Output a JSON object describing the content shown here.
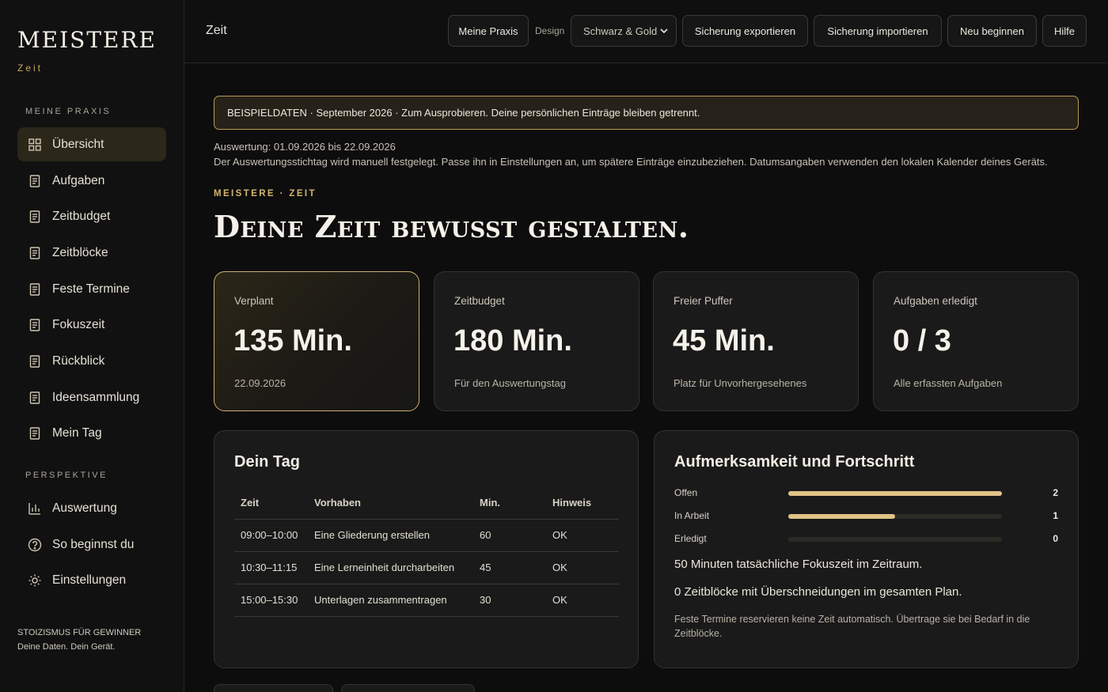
{
  "brand": {
    "title": "MEISTERE",
    "subtitle": "Zeit"
  },
  "sidebar": {
    "section_main": "MEINE PRAXIS",
    "items": [
      {
        "label": "Übersicht",
        "icon": "grid-icon",
        "active": true
      },
      {
        "label": "Aufgaben",
        "icon": "document-icon"
      },
      {
        "label": "Zeitbudget",
        "icon": "document-icon"
      },
      {
        "label": "Zeitblöcke",
        "icon": "document-icon"
      },
      {
        "label": "Feste Termine",
        "icon": "document-icon"
      },
      {
        "label": "Fokuszeit",
        "icon": "document-icon"
      },
      {
        "label": "Rückblick",
        "icon": "document-icon"
      },
      {
        "label": "Ideensammlung",
        "icon": "document-icon"
      },
      {
        "label": "Mein Tag",
        "icon": "document-icon"
      }
    ],
    "section_perspective": "PERSPEKTIVE",
    "perspective_items": [
      {
        "label": "Auswertung",
        "icon": "bar-chart-icon"
      },
      {
        "label": "So beginnst du",
        "icon": "help-circle-icon"
      },
      {
        "label": "Einstellungen",
        "icon": "sun-gear-icon"
      }
    ],
    "footer_line1": "STOIZISMUS FÜR GEWINNER",
    "footer_line2": "Deine Daten. Dein Gerät."
  },
  "topbar": {
    "title": "Zeit",
    "my_practice": "Meine Praxis",
    "design_label": "Design",
    "design_value": "Schwarz & Gold",
    "export": "Sicherung exportieren",
    "import": "Sicherung importieren",
    "restart": "Neu beginnen",
    "help": "Hilfe"
  },
  "banner": "BEISPIELDATEN · September 2026 · Zum Ausprobieren. Deine persönlichen Einträge bleiben getrennt.",
  "meta": {
    "range": "Auswertung: 01.09.2026 bis 22.09.2026",
    "note": "Der Auswertungsstichtag wird manuell festgelegt. Passe ihn in Einstellungen an, um spätere Einträge einzubeziehen. Datumsangaben verwenden den lokalen Kalender deines Geräts."
  },
  "eyebrow": "MEISTERE · ZEIT",
  "hero": "Deine Zeit bewusst gestalten.",
  "stats": [
    {
      "label": "Verplant",
      "value": "135 Min.",
      "sub": "22.09.2026"
    },
    {
      "label": "Zeitbudget",
      "value": "180 Min.",
      "sub": "Für den Auswertungstag"
    },
    {
      "label": "Freier Puffer",
      "value": "45 Min.",
      "sub": "Platz für Unvorhergesehenes"
    },
    {
      "label": "Aufgaben erledigt",
      "value": "0 / 3",
      "sub": "Alle erfassten Aufgaben"
    }
  ],
  "day": {
    "title": "Dein Tag",
    "headers": [
      "Zeit",
      "Vorhaben",
      "Min.",
      "Hinweis"
    ],
    "rows": [
      [
        "09:00–10:00",
        "Eine Gliederung erstellen",
        "60",
        "OK"
      ],
      [
        "10:30–11:15",
        "Eine Lerneinheit durcharbeiten",
        "45",
        "OK"
      ],
      [
        "15:00–15:30",
        "Unterlagen zusammentragen",
        "30",
        "OK"
      ]
    ]
  },
  "progress": {
    "title": "Aufmerksamkeit und Fortschritt",
    "bars": [
      {
        "label": "Offen",
        "value": "2",
        "fraction": 1.0
      },
      {
        "label": "In Arbeit",
        "value": "1",
        "fraction": 0.5
      },
      {
        "label": "Erledigt",
        "value": "0",
        "fraction": 0.0
      }
    ],
    "line1": "50 Minuten tatsächliche Fokuszeit im Zeitraum.",
    "line2": "0 Zeitblöcke mit Überschneidungen im gesamten Plan.",
    "note": "Feste Termine reservieren keine Zeit automatisch. Übertrage sie bei Bedarf in die Zeitblöcke."
  },
  "colors": {
    "accent": "#c9a961",
    "background": "#0d0d0d",
    "card": "#1a1a1a"
  }
}
